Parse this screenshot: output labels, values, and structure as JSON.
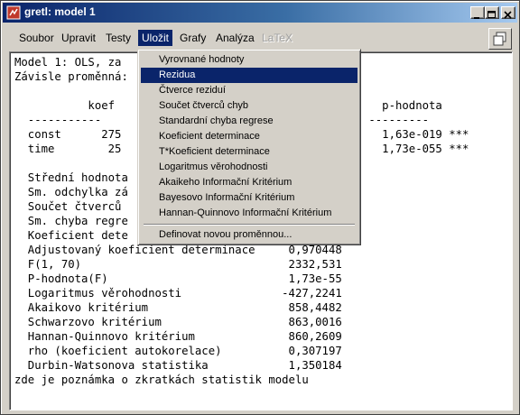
{
  "window": {
    "title": "gretl: model 1",
    "buttons": {
      "minimize": "_",
      "maximize": "□",
      "close": "✕"
    }
  },
  "menubar": {
    "items": [
      {
        "label": "Soubor"
      },
      {
        "label": "Upravit"
      },
      {
        "label": "Testy"
      },
      {
        "label": "Uložit"
      },
      {
        "label": "Grafy"
      },
      {
        "label": "Analýza"
      },
      {
        "label": "LaTeX"
      }
    ]
  },
  "dropdown": {
    "items": [
      {
        "label": "Vyrovnané hodnoty"
      },
      {
        "label": "Rezidua"
      },
      {
        "label": "Čtverce reziduí"
      },
      {
        "label": "Součet čtverců chyb"
      },
      {
        "label": "Standardní chyba regrese"
      },
      {
        "label": "Koeficient determinace"
      },
      {
        "label": "T*Koeficient determinace"
      },
      {
        "label": "Logaritmus věrohodnosti"
      },
      {
        "label": "Akaikeho Informační Kritérium"
      },
      {
        "label": "Bayesovo Informační Kritérium"
      },
      {
        "label": "Hannan-Quinnovo Informační Kritérium"
      },
      {
        "label": "Definovat novou proměnnou..."
      }
    ]
  },
  "output": {
    "lines": [
      "Model 1: OLS, za",
      "Závisle proměnná:",
      "",
      "           koef                                        p-hodnota",
      "  -----------                                        ---------",
      "  const      275                                       1,63e-019 ***",
      "  time        25                                       1,73e-055 ***",
      "",
      "  Střední hodnota",
      "  Sm. odchylka zá",
      "  Součet čtverců",
      "  Sm. chyba regre",
      "  Koeficient dete",
      "  Adjustovaný koeficient determinace     0,970448",
      "  F(1, 70)                               2332,531",
      "  P-hodnota(F)                           1,73e-55",
      "  Logaritmus věrohodnosti               -427,2241",
      "  Akaikovo kritérium                     858,4482",
      "  Schwarzovo kritérium                   863,0016",
      "  Hannan-Quinnovo kritérium              860,2609",
      "  rho (koeficient autokorelace)          0,307197",
      "  Durbin-Watsonova statistika            1,350184",
      "zde je poznámka o zkratkách statistik modelu"
    ]
  }
}
